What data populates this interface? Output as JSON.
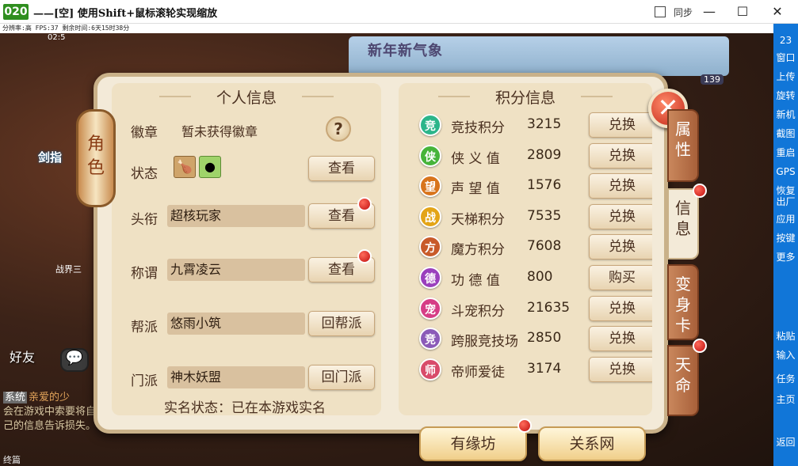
{
  "window": {
    "app_number": "020",
    "title": "——[空] 使用Shift+鼠标滚轮实现缩放",
    "sync_label": "同步",
    "min": "—",
    "max": "☐",
    "close": "✕"
  },
  "status_line": "分辨率:高 FPS:37 剩余时间:6天15时38分",
  "game_bg": {
    "banner": "新年新气象",
    "clock": "02:5",
    "level": "139",
    "jianzhi": "剑指",
    "jiejie": "战界三",
    "haoyou": "好友",
    "chat_icon": "💬",
    "chat": {
      "sys": "系统",
      "line1": "亲爱的少",
      "rest": "会在游戏中索要将自己的信息告诉损失。"
    },
    "bottom_name": "终篇"
  },
  "panel": {
    "lantern": "角色",
    "close": "✕",
    "left_title": "个人信息",
    "right_title": "积分信息",
    "badge_label": "徽章",
    "badge_value": "暂未获得徽章",
    "help": "?",
    "status_label": "状态",
    "status_btn": "查看",
    "head_label": "头衔",
    "head_value": "超核玩家",
    "head_btn": "查看",
    "title_label": "称谓",
    "title_value": "九霄凌云",
    "title_btn": "查看",
    "gang_label": "帮派",
    "gang_value": "悠雨小筑",
    "gang_btn": "回帮派",
    "sect_label": "门派",
    "sect_value": "神木妖盟",
    "sect_btn": "回门派",
    "realname": "实名状态：已在本游戏实名",
    "points": [
      {
        "icon": "竞",
        "color": "#2bb58a",
        "name": "竞技积分",
        "value": "3215",
        "btn": "兑换"
      },
      {
        "icon": "侠",
        "color": "#47b43a",
        "name": "侠 义 值",
        "value": "2809",
        "btn": "兑换"
      },
      {
        "icon": "望",
        "color": "#d8741c",
        "name": "声 望 值",
        "value": "1576",
        "btn": "兑换"
      },
      {
        "icon": "战",
        "color": "#e3a417",
        "name": "天梯积分",
        "value": "7535",
        "btn": "兑换"
      },
      {
        "icon": "方",
        "color": "#c85a2a",
        "name": "魔方积分",
        "value": "7608",
        "btn": "兑换"
      },
      {
        "icon": "德",
        "color": "#9a3fbd",
        "name": "功 德 值",
        "value": "800",
        "btn": "购买"
      },
      {
        "icon": "宠",
        "color": "#d63d86",
        "name": "斗宠积分",
        "value": "21635",
        "btn": "兑换"
      },
      {
        "icon": "竞",
        "color": "#8b5ab8",
        "name": "跨服竞技场",
        "value": "2850",
        "btn": "兑换"
      },
      {
        "icon": "师",
        "color": "#d84b6a",
        "name": "帝师爱徒",
        "value": "3174",
        "btn": "兑换"
      }
    ],
    "btn_youyuan": "有缘坊",
    "btn_guanxi": "关系网",
    "tabs": [
      "属性",
      "信息",
      "变身卡",
      "天命"
    ]
  },
  "sidebar": {
    "num": "23",
    "items": [
      "窗口",
      "上传",
      "旋转",
      "新机",
      "截图",
      "重启",
      "GPS",
      "恢复出厂",
      "应用",
      "按键",
      "更多",
      "粘贴",
      "输入",
      "任务",
      "主页",
      "返回"
    ]
  },
  "colors": {
    "sidebar": "#1176d8",
    "accent_red": "#c32818",
    "panel_bg": "#f3ead8"
  }
}
